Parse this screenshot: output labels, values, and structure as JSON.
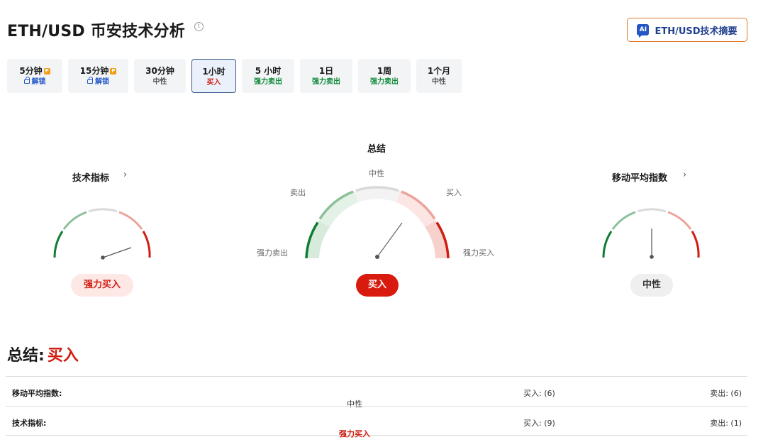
{
  "header": {
    "title": "ETH/USD 币安技术分析",
    "ai_button": "ETH/USD技术摘要",
    "ai_badge": "AI"
  },
  "timeframes": [
    {
      "label": "5分钟",
      "sub": "解锁",
      "pro": true
    },
    {
      "label": "15分钟",
      "sub": "解锁",
      "pro": true
    },
    {
      "label": "30分钟",
      "sub": "中性"
    },
    {
      "label": "1小时",
      "sub": "买入",
      "active": true
    },
    {
      "label": "5 小时",
      "sub": "强力卖出"
    },
    {
      "label": "1日",
      "sub": "强力卖出"
    },
    {
      "label": "1周",
      "sub": "强力卖出"
    },
    {
      "label": "1个月",
      "sub": "中性"
    }
  ],
  "gauges": {
    "technical": {
      "title": "技术指标",
      "result": "强力买入"
    },
    "summary": {
      "title": "总结",
      "result": "买入",
      "labels": {
        "neutral": "中性",
        "sell": "卖出",
        "buy": "买入",
        "strong_sell": "强力卖出",
        "strong_buy": "强力买入"
      }
    },
    "moving_averages": {
      "title": "移动平均指数",
      "result": "中性"
    }
  },
  "summary": {
    "label": "总结:",
    "value": "买入"
  },
  "table": [
    {
      "name": "移动平均指数:",
      "status": "中性",
      "buy": "买入: (6)",
      "sell": "卖出: (6)"
    },
    {
      "name": "技术指标:",
      "status": "强力买入",
      "buy": "买入: (9)",
      "sell": "卖出: (1)"
    }
  ],
  "colors": {
    "strong_sell": "#0f7d32",
    "sell": "#8cc09a",
    "neutral": "#d9d9d9",
    "buy": "#eba49b",
    "strong_buy": "#d01c11",
    "accent_blue": "#2457c5"
  }
}
